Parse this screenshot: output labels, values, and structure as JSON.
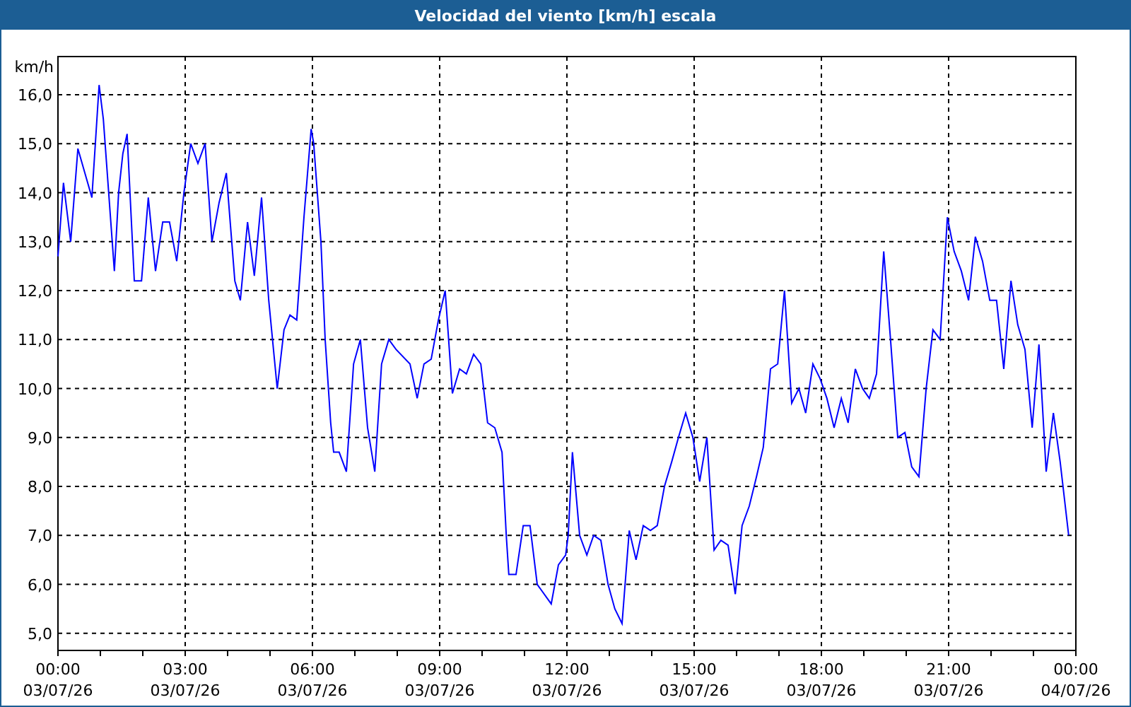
{
  "window": {
    "title": "Velocidad del viento [km/h] escala"
  },
  "chart": {
    "x_tick_dates": [
      "03/07/26",
      "03/07/26",
      "03/07/26",
      "03/07/26",
      "03/07/26",
      "03/07/26",
      "03/07/26",
      "03/07/26",
      "04/07/26"
    ],
    "chart_data": {
      "type": "line",
      "ylabel": "km/h",
      "ylim": [
        4.65,
        16.78
      ],
      "xlim": [
        0,
        24
      ],
      "yticks": [
        {
          "value": 5,
          "label": "5,0"
        },
        {
          "value": 6,
          "label": "6,0"
        },
        {
          "value": 7,
          "label": "7,0"
        },
        {
          "value": 8,
          "label": "8,0"
        },
        {
          "value": 9,
          "label": "9,0"
        },
        {
          "value": 10,
          "label": "10,0"
        },
        {
          "value": 11,
          "label": "11,0"
        },
        {
          "value": 12,
          "label": "12,0"
        },
        {
          "value": 13,
          "label": "13,0"
        },
        {
          "value": 14,
          "label": "14,0"
        },
        {
          "value": 15,
          "label": "15,0"
        },
        {
          "value": 16,
          "label": "16,0"
        }
      ],
      "xticks": [
        {
          "value": 0,
          "label": "00:00"
        },
        {
          "value": 3,
          "label": "03:00"
        },
        {
          "value": 6,
          "label": "06:00"
        },
        {
          "value": 9,
          "label": "09:00"
        },
        {
          "value": 12,
          "label": "12:00"
        },
        {
          "value": 15,
          "label": "15:00"
        },
        {
          "value": 18,
          "label": "18:00"
        },
        {
          "value": 21,
          "label": "21:00"
        },
        {
          "value": 24,
          "label": "00:00"
        }
      ],
      "x": [
        0,
        0.13,
        0.3,
        0.47,
        0.8,
        0.97,
        1.07,
        1.33,
        1.43,
        1.53,
        1.63,
        1.8,
        1.97,
        2.13,
        2.3,
        2.47,
        2.63,
        2.8,
        2.97,
        3.13,
        3.3,
        3.47,
        3.63,
        3.8,
        3.97,
        4.17,
        4.3,
        4.47,
        4.63,
        4.8,
        4.97,
        5.17,
        5.33,
        5.47,
        5.63,
        5.8,
        5.97,
        6.03,
        6.2,
        6.3,
        6.43,
        6.5,
        6.63,
        6.8,
        6.97,
        7.13,
        7.3,
        7.47,
        7.63,
        7.8,
        7.97,
        8.3,
        8.47,
        8.63,
        8.8,
        8.97,
        9.13,
        9.3,
        9.47,
        9.63,
        9.8,
        9.97,
        10.13,
        10.3,
        10.47,
        10.57,
        10.63,
        10.8,
        10.97,
        11.13,
        11.3,
        11.63,
        11.8,
        11.97,
        12.03,
        12.13,
        12.3,
        12.47,
        12.63,
        12.8,
        12.97,
        13.13,
        13.3,
        13.47,
        13.63,
        13.8,
        13.97,
        14.13,
        14.3,
        14.47,
        14.63,
        14.8,
        14.97,
        15.13,
        15.3,
        15.47,
        15.63,
        15.8,
        15.97,
        16.13,
        16.3,
        16.47,
        16.63,
        16.8,
        16.97,
        17.13,
        17.3,
        17.47,
        17.63,
        17.8,
        17.97,
        18.13,
        18.3,
        18.47,
        18.63,
        18.8,
        18.97,
        19.13,
        19.3,
        19.47,
        19.63,
        19.8,
        19.97,
        20.13,
        20.3,
        20.47,
        20.63,
        20.8,
        20.97,
        21.13,
        21.3,
        21.47,
        21.63,
        21.8,
        21.97,
        22.13,
        22.3,
        22.47,
        22.63,
        22.8,
        22.97,
        23.13,
        23.3,
        23.47,
        23.63,
        23.83
      ],
      "grid": true,
      "series": [
        {
          "color": "#0000ff",
          "values": [
            12.7,
            14.2,
            13.0,
            14.9,
            13.9,
            16.2,
            15.5,
            12.4,
            14.0,
            14.8,
            15.2,
            12.2,
            12.2,
            13.9,
            12.4,
            13.4,
            13.4,
            12.6,
            14.0,
            15.0,
            14.6,
            15.0,
            13.0,
            13.8,
            14.4,
            12.2,
            11.8,
            13.4,
            12.3,
            13.9,
            11.8,
            10.0,
            11.2,
            11.5,
            11.4,
            13.5,
            15.3,
            15.0,
            13.0,
            11.0,
            9.3,
            8.7,
            8.7,
            8.3,
            10.5,
            11.0,
            9.2,
            8.3,
            10.5,
            11.0,
            10.8,
            10.5,
            9.8,
            10.5,
            10.6,
            11.4,
            12.0,
            9.9,
            10.4,
            10.3,
            10.7,
            10.5,
            9.3,
            9.2,
            8.7,
            7.0,
            6.2,
            6.2,
            7.2,
            7.2,
            6.0,
            5.6,
            6.4,
            6.6,
            7.0,
            8.7,
            7.0,
            6.6,
            7.0,
            6.9,
            6.0,
            5.5,
            5.2,
            7.1,
            6.5,
            7.2,
            7.1,
            7.2,
            8.0,
            8.5,
            9.0,
            9.5,
            9.0,
            8.1,
            9.0,
            6.7,
            6.9,
            6.8,
            5.8,
            7.2,
            7.6,
            8.2,
            8.8,
            10.4,
            10.5,
            12.0,
            9.7,
            10.0,
            9.5,
            10.5,
            10.2,
            9.8,
            9.2,
            9.8,
            9.3,
            10.4,
            10.0,
            9.8,
            10.3,
            12.8,
            11.0,
            9.0,
            9.1,
            8.4,
            8.2,
            10.0,
            11.2,
            11.0,
            13.5,
            12.8,
            12.4,
            11.8,
            13.1,
            12.6,
            11.8,
            11.8,
            10.4,
            12.2,
            11.3,
            10.8,
            9.2,
            10.9,
            8.3,
            9.5,
            8.5,
            7.0
          ]
        }
      ]
    }
  }
}
